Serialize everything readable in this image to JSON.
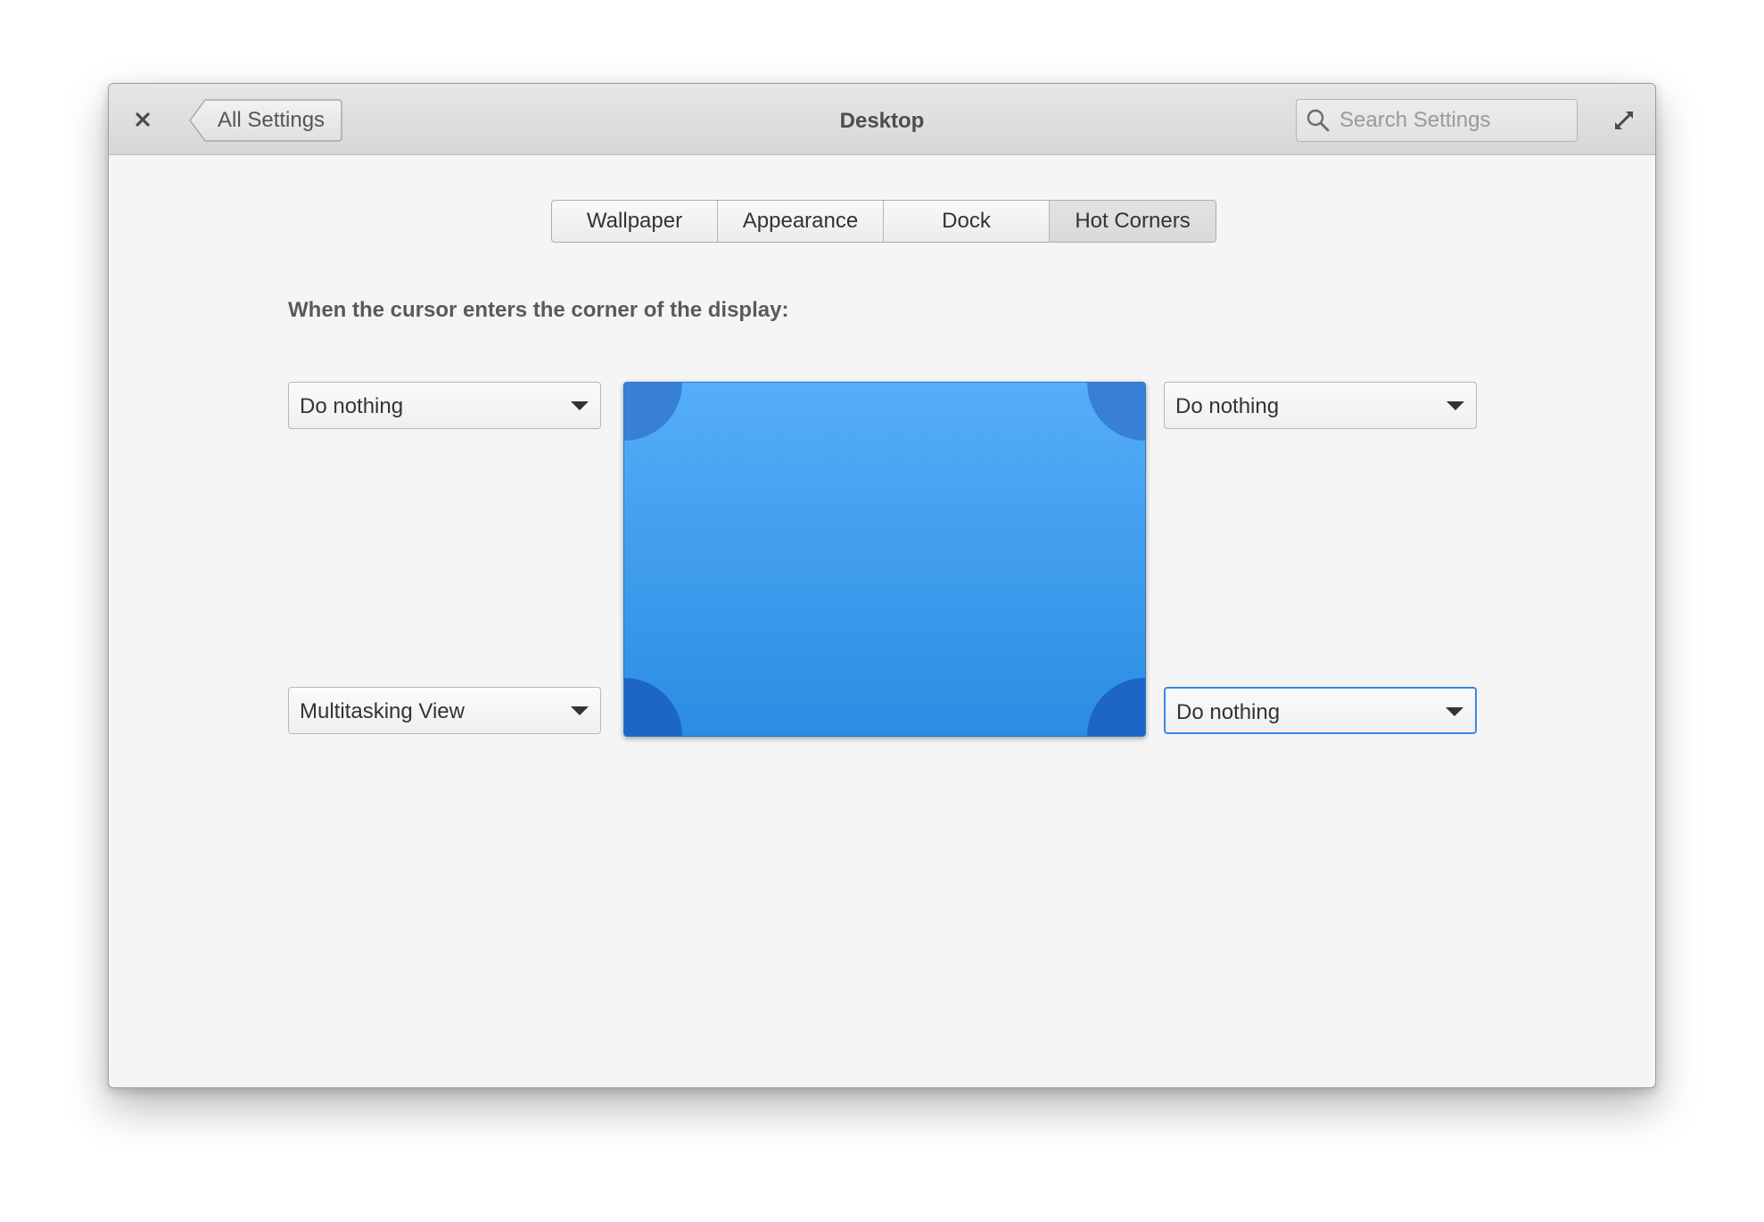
{
  "window": {
    "title": "Desktop",
    "back_label": "All Settings",
    "search_placeholder": "Search Settings"
  },
  "icons": {
    "close": "close-icon",
    "back": "back-arrow-icon",
    "search": "search-icon",
    "maximize": "maximize-icon",
    "dropdown": "chevron-down-icon"
  },
  "tabs": [
    {
      "label": "Wallpaper",
      "active": false
    },
    {
      "label": "Appearance",
      "active": false
    },
    {
      "label": "Dock",
      "active": false
    },
    {
      "label": "Hot Corners",
      "active": true
    }
  ],
  "hot_corners": {
    "heading": "When the cursor enters the corner of the display:",
    "top_left": "Do nothing",
    "top_right": "Do nothing",
    "bottom_left": "Multitasking View",
    "bottom_right": "Do nothing"
  },
  "colors": {
    "accent": "#3689e6",
    "screen_top": "#55aef8",
    "screen_bottom": "#2b8de2",
    "corner_top": "#3780d6",
    "corner_bottom": "#1d65c6"
  }
}
